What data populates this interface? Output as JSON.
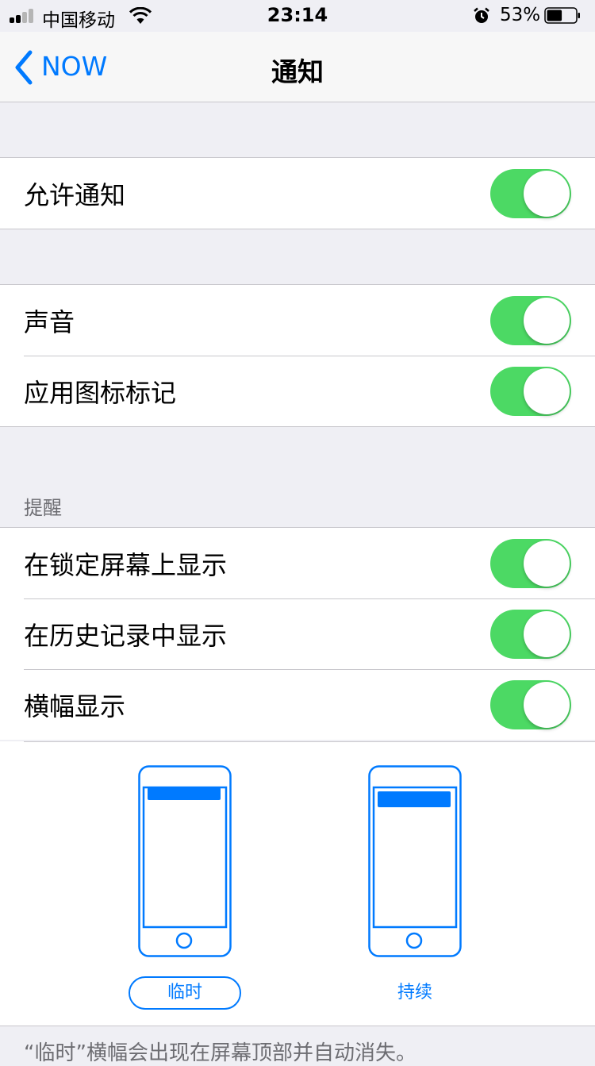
{
  "status_bar": {
    "carrier": "中国移动",
    "time": "23:14",
    "battery_percent": "53%",
    "battery_level": 0.53,
    "icons": [
      "signal-icon",
      "wifi-icon",
      "alarm-icon",
      "battery-icon"
    ]
  },
  "nav": {
    "back_label": "NOW",
    "title": "通知"
  },
  "groups": {
    "allow": {
      "label": "允许通知",
      "on": true
    },
    "sound": {
      "label": "声音",
      "on": true
    },
    "badge": {
      "label": "应用图标标记",
      "on": true
    }
  },
  "alerts": {
    "header": "提醒",
    "lock_screen": {
      "label": "在锁定屏幕上显示",
      "on": true
    },
    "history": {
      "label": "在历史记录中显示",
      "on": true
    },
    "banner": {
      "label": "横幅显示",
      "on": true
    }
  },
  "banner_styles": {
    "temporary": {
      "label": "临时",
      "selected": true
    },
    "persistent": {
      "label": "持续",
      "selected": false
    }
  },
  "footer_note": "“临时”横幅会出现在屏幕顶部并自动消失。",
  "colors": {
    "accent": "#007aff",
    "switch_on": "#4cd964",
    "background": "#efeff4"
  }
}
